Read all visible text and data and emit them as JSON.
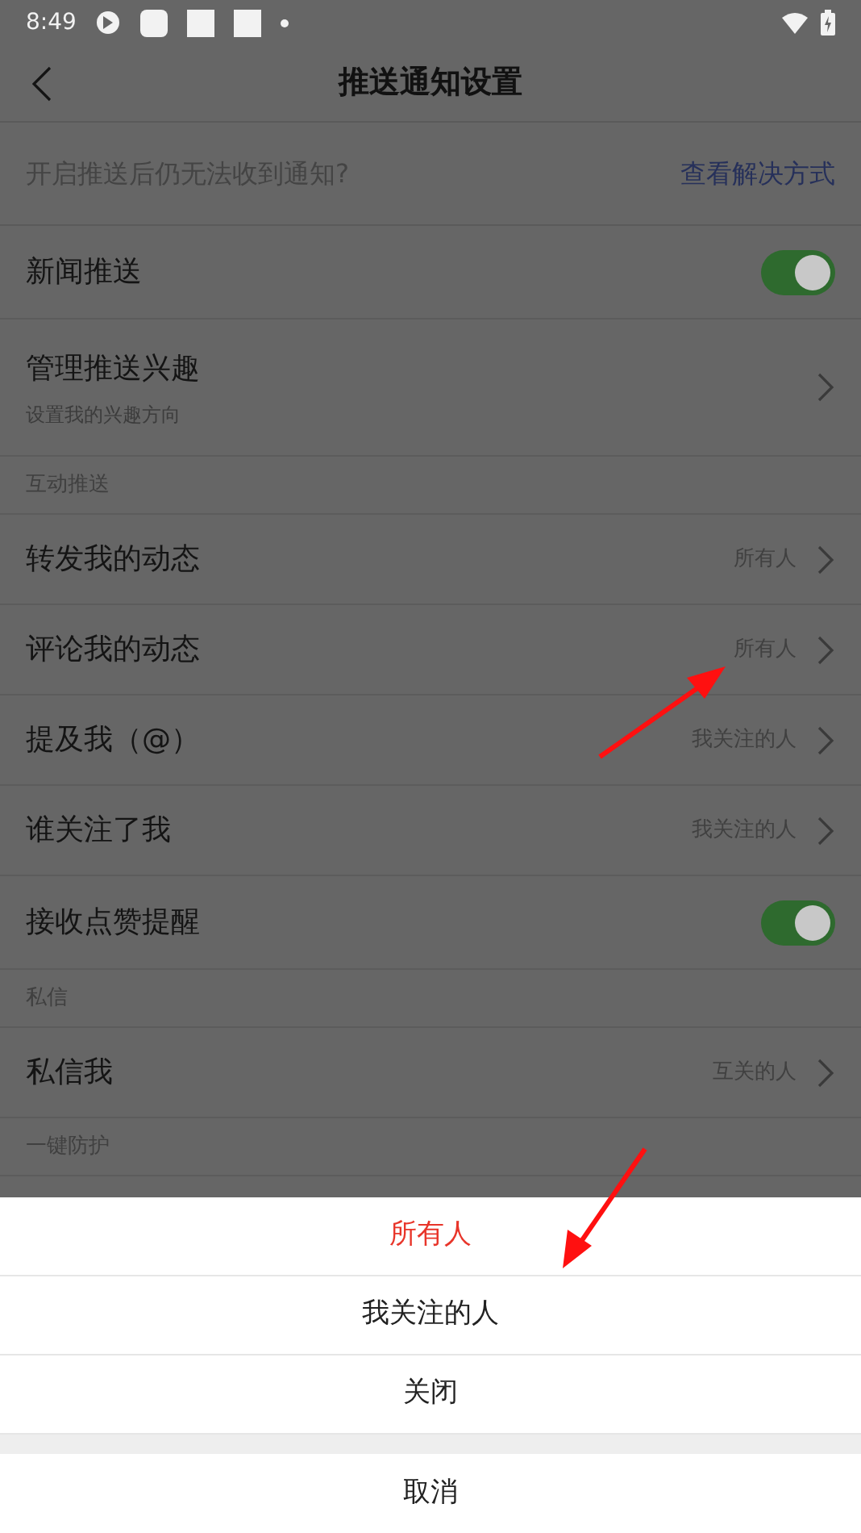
{
  "status_bar": {
    "time": "8:49"
  },
  "header": {
    "title": "推送通知设置"
  },
  "hint": {
    "text": "开启推送后仍无法收到通知?",
    "link": "查看解决方式"
  },
  "rows": [
    {
      "kind": "toggle",
      "label": "新闻推送",
      "on": true
    },
    {
      "kind": "nav",
      "label": "管理推送兴趣",
      "subtitle": "设置我的兴趣方向"
    },
    {
      "kind": "section",
      "label": "互动推送"
    },
    {
      "kind": "nav",
      "label": "转发我的动态",
      "value": "所有人"
    },
    {
      "kind": "nav",
      "label": "评论我的动态",
      "value": "所有人"
    },
    {
      "kind": "nav",
      "label": "提及我（@）",
      "value": "我关注的人"
    },
    {
      "kind": "nav",
      "label": "谁关注了我",
      "value": "我关注的人"
    },
    {
      "kind": "toggle",
      "label": "接收点赞提醒",
      "on": true
    },
    {
      "kind": "section",
      "label": "私信"
    },
    {
      "kind": "nav",
      "label": "私信我",
      "value": "互关的人"
    },
    {
      "kind": "section",
      "label": "一键防护"
    }
  ],
  "sheet": {
    "options": [
      {
        "label": "所有人",
        "selected": true
      },
      {
        "label": "我关注的人",
        "selected": false
      },
      {
        "label": "关闭",
        "selected": false
      }
    ],
    "cancel": "取消"
  }
}
